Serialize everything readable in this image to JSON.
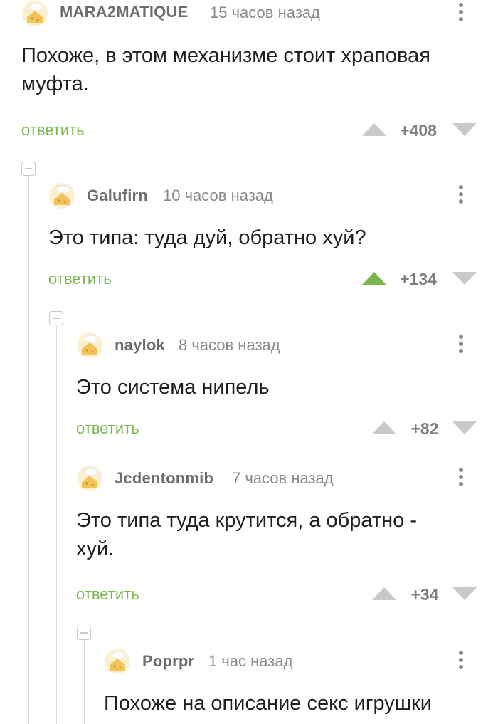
{
  "comments": [
    {
      "author": "MARA2MATIQUE",
      "time": "15 часов назад",
      "text": "Похоже, в этом механизме стоит храповая муфта.",
      "reply": "ответить",
      "score": "+408",
      "upvoted": false
    },
    {
      "author": "Galufirn",
      "time": "10 часов назад",
      "text": "Это типа: туда дуй, обратно хуй?",
      "reply": "ответить",
      "score": "+134",
      "upvoted": true
    },
    {
      "author": "naylok",
      "time": "8 часов назад",
      "text": "Это система нипель",
      "reply": "ответить",
      "score": "+82",
      "upvoted": false
    },
    {
      "author": "Jcdentonmib",
      "time": "7 часов назад",
      "text": "Это типа туда крутится, а обратно - хуй.",
      "reply": "ответить",
      "score": "+34",
      "upvoted": false
    },
    {
      "author": "Poprpr",
      "time": "1 час назад",
      "text": "Похоже на описание секс игрушки",
      "reply": "",
      "score": "",
      "upvoted": false
    }
  ],
  "colors": {
    "accent": "#78b84a",
    "muted": "#8a8a8a",
    "line": "#dcdcdc"
  },
  "icons": {
    "avatar": "default-avatar-icon",
    "more": "more-vertical-icon",
    "upvote": "upvote-triangle-icon",
    "downvote": "downvote-triangle-icon",
    "collapse": "collapse-thread-icon"
  }
}
